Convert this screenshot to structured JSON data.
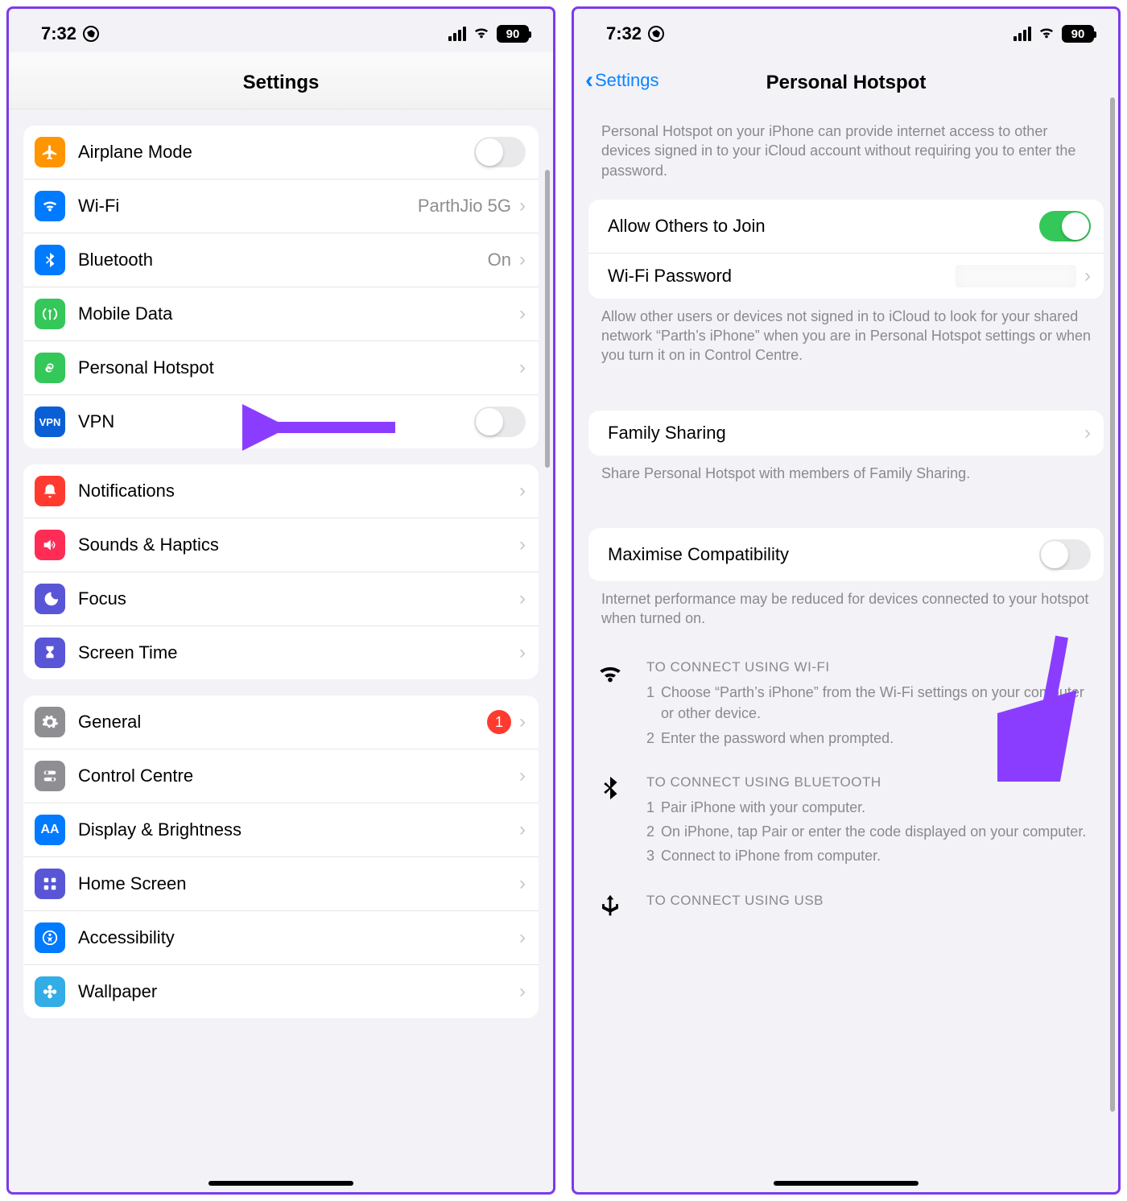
{
  "status": {
    "time": "7:32",
    "battery": "90"
  },
  "left": {
    "title": "Settings",
    "g1": [
      {
        "key": "airplane",
        "label": "Airplane Mode",
        "toggle": false,
        "color": "ic-orange"
      },
      {
        "key": "wifi",
        "label": "Wi-Fi",
        "detail": "ParthJio 5G",
        "color": "ic-blue"
      },
      {
        "key": "bluetooth",
        "label": "Bluetooth",
        "detail": "On",
        "color": "ic-blue"
      },
      {
        "key": "mobiledata",
        "label": "Mobile Data",
        "color": "ic-green"
      },
      {
        "key": "hotspot",
        "label": "Personal Hotspot",
        "color": "ic-green"
      },
      {
        "key": "vpn",
        "label": "VPN",
        "toggle": false,
        "color": "ic-navy",
        "text": "VPN"
      }
    ],
    "g2": [
      {
        "key": "notifications",
        "label": "Notifications",
        "color": "ic-red"
      },
      {
        "key": "sounds",
        "label": "Sounds & Haptics",
        "color": "ic-pink"
      },
      {
        "key": "focus",
        "label": "Focus",
        "color": "ic-indigo"
      },
      {
        "key": "screentime",
        "label": "Screen Time",
        "color": "ic-indigo"
      }
    ],
    "g3": [
      {
        "key": "general",
        "label": "General",
        "badge": "1",
        "color": "ic-grey"
      },
      {
        "key": "controlcentre",
        "label": "Control Centre",
        "color": "ic-darkgrey"
      },
      {
        "key": "display",
        "label": "Display & Brightness",
        "color": "ic-blue"
      },
      {
        "key": "homescreen",
        "label": "Home Screen",
        "color": "ic-indigo"
      },
      {
        "key": "accessibility",
        "label": "Accessibility",
        "color": "ic-blue"
      },
      {
        "key": "wallpaper",
        "label": "Wallpaper",
        "color": "ic-cyan"
      }
    ]
  },
  "right": {
    "back": "Settings",
    "title": "Personal Hotspot",
    "intro": "Personal Hotspot on your iPhone can provide internet access to other devices signed in to your iCloud account without requiring you to enter the password.",
    "allow": {
      "label": "Allow Others to Join",
      "on": true
    },
    "wifipw": {
      "label": "Wi-Fi Password"
    },
    "allowFooter": "Allow other users or devices not signed in to iCloud to look for your shared network “Parth’s iPhone” when you are in Personal Hotspot settings or when you turn it on in Control Centre.",
    "family": {
      "label": "Family Sharing"
    },
    "familyFooter": "Share Personal Hotspot with members of Family Sharing.",
    "maxcompat": {
      "label": "Maximise Compatibility",
      "on": false
    },
    "maxFooter": "Internet performance may be reduced for devices connected to your hotspot when turned on.",
    "connectWifi": {
      "title": "TO CONNECT USING WI-FI",
      "steps": [
        "Choose “Parth’s iPhone” from the Wi-Fi settings on your computer or other device.",
        "Enter the password when prompted."
      ]
    },
    "connectBt": {
      "title": "TO CONNECT USING BLUETOOTH",
      "steps": [
        "Pair iPhone with your computer.",
        "On iPhone, tap Pair or enter the code displayed on your computer.",
        "Connect to iPhone from computer."
      ]
    },
    "connectUsb": {
      "title": "TO CONNECT USING USB"
    }
  }
}
